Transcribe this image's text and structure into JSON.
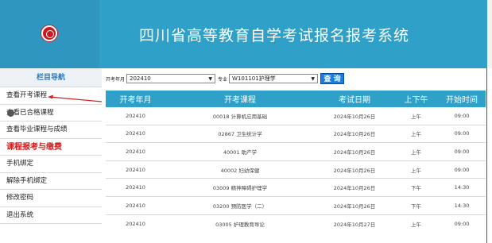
{
  "header": {
    "title": "四川省高等教育自学考试报名报考系统"
  },
  "sidebar": {
    "header": "栏目导航",
    "items": [
      {
        "label": "查看开考课程"
      },
      {
        "label": "查看已合格课程"
      },
      {
        "label": "查看毕业课程与成绩"
      },
      {
        "label": "课程报考与缴费"
      },
      {
        "label": "手机绑定"
      },
      {
        "label": "解除手机绑定"
      },
      {
        "label": "修改密码"
      },
      {
        "label": "退出系统"
      }
    ]
  },
  "toolbar": {
    "year_label": "开考年月",
    "year_value": "202410",
    "major_label": "专业",
    "major_value": "W101101护理学",
    "query_label": "查 询"
  },
  "table": {
    "headers": [
      "开考年月",
      "开考课程",
      "考试日期",
      "上下午",
      "开始时间"
    ],
    "rows": [
      [
        "202410",
        "00018 计算机应用基础",
        "2024年10月26日",
        "上午",
        "09:00"
      ],
      [
        "202410",
        "02867 卫生统计学",
        "2024年10月26日",
        "上午",
        "09:00"
      ],
      [
        "202410",
        "40001 助产学",
        "2024年10月26日",
        "上午",
        "09:00"
      ],
      [
        "202410",
        "40002 妇幼保健",
        "2024年10月26日",
        "上午",
        "09:00"
      ],
      [
        "202410",
        "03009 精神障碍护理学",
        "2024年10月26日",
        "下午",
        "14:30"
      ],
      [
        "202410",
        "03200 预防医学（二）",
        "2024年10月26日",
        "下午",
        "14:30"
      ],
      [
        "202410",
        "03005 护理教育导论",
        "2024年10月27日",
        "上午",
        "09:00"
      ]
    ]
  },
  "colors": {
    "header_blue": "#2fa0c8",
    "active_red": "#d02020",
    "query_blue": "#1a7be0"
  }
}
